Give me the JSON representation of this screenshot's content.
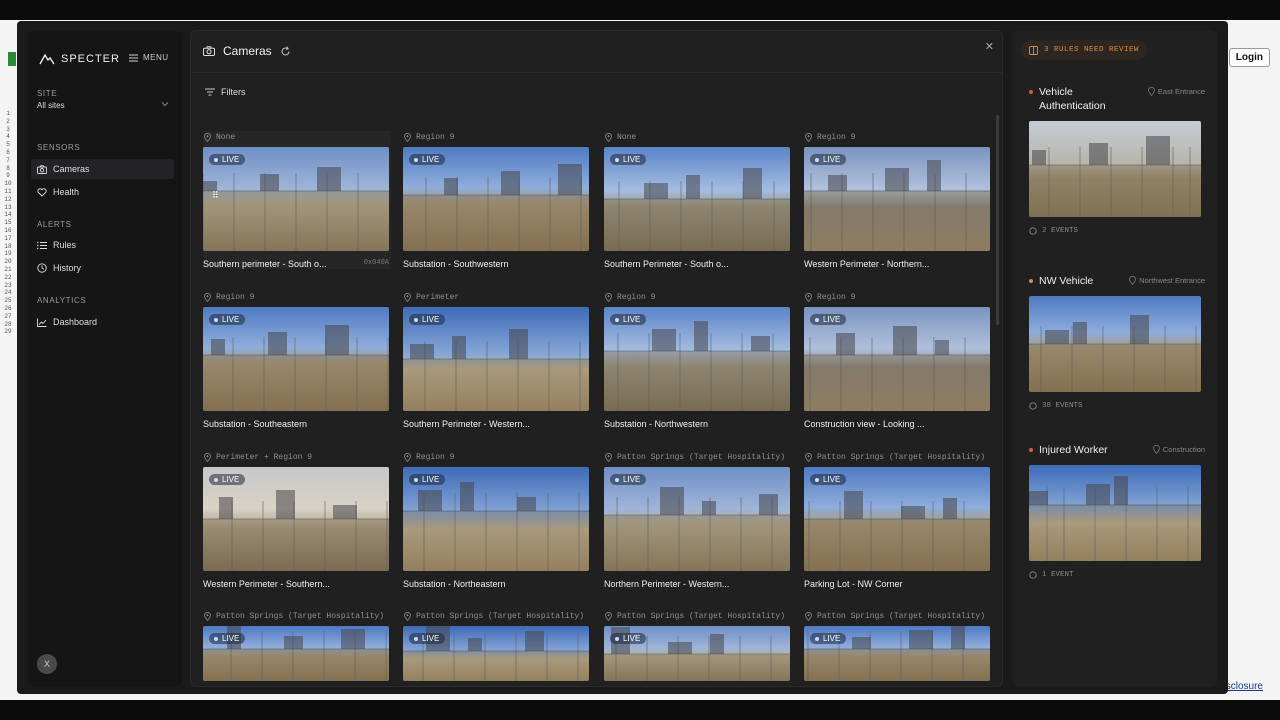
{
  "sidebar": {
    "brand": "SPECTER",
    "menu_label": "MENU",
    "site_section": "SITE",
    "site_value": "All sites",
    "sensors_section": "SENSORS",
    "sensors_items": [
      {
        "label": "Cameras"
      },
      {
        "label": "Health"
      }
    ],
    "alerts_section": "ALERTS",
    "alerts_items": [
      {
        "label": "Rules"
      },
      {
        "label": "History"
      }
    ],
    "analytics_section": "ANALYTICS",
    "analytics_items": [
      {
        "label": "Dashboard"
      }
    ],
    "user_initial": "X"
  },
  "main": {
    "title": "Cameras",
    "filters_label": "Filters",
    "live_label": "LIVE",
    "cameras": [
      {
        "region": "None",
        "title": "Southern perimeter - South o...",
        "code": "0x040A",
        "scene": "sky-a"
      },
      {
        "region": "Region 9",
        "title": "Substation - Southwestern",
        "scene": "sky-b"
      },
      {
        "region": "None",
        "title": "Southern Perimeter - South o...",
        "scene": "sky-c"
      },
      {
        "region": "Region 9",
        "title": "Western Perimeter - Northern...",
        "scene": "sky-d"
      },
      {
        "region": "Region 9",
        "title": "Substation - Southeastern",
        "scene": "sky-b"
      },
      {
        "region": "Perimeter",
        "title": "Southern Perimeter - Western...",
        "scene": "sky-e"
      },
      {
        "region": "Region 9",
        "title": "Substation - Northwestern",
        "scene": "sky-c"
      },
      {
        "region": "Region 9",
        "title": "Construction view - Looking ...",
        "scene": "sky-d"
      },
      {
        "region": "Perimeter + Region 9",
        "title": "Western Perimeter - Southern...",
        "scene": "sky-f"
      },
      {
        "region": "Region 9",
        "title": "Substation - Northeastern",
        "scene": "sky-e"
      },
      {
        "region": "Patton Springs (Target Hospitality)",
        "title": "Northern Perimeter - Western...",
        "scene": "sky-a"
      },
      {
        "region": "Patton Springs (Target Hospitality)",
        "title": "Parking Lot - NW Corner",
        "scene": "sky-b"
      },
      {
        "region": "Patton Springs (Target Hospitality)",
        "title": "",
        "scene": "sky-b"
      },
      {
        "region": "Patton Springs (Target Hospitality)",
        "title": "",
        "scene": "sky-e"
      },
      {
        "region": "Patton Springs (Target Hospitality)",
        "title": "",
        "scene": "sky-a"
      },
      {
        "region": "Patton Springs (Target Hospitality)",
        "title": "",
        "scene": "sky-b"
      }
    ]
  },
  "review": {
    "badge": "3 RULES NEED REVIEW",
    "alerts": [
      {
        "name": "Vehicle Authentication",
        "location": "East Entrance",
        "count": "2 EVENTS",
        "dot_color": "#d9534f",
        "scene": "sky-g"
      },
      {
        "name": "NW Vehicle",
        "location": "Northwest Entrance",
        "count": "38 EVENTS",
        "dot_color": "#e0823c",
        "scene": "sky-b"
      },
      {
        "name": "Injured Worker",
        "location": "Construction",
        "count": "1 EVENT",
        "dot_color": "#d9534f",
        "scene": "sky-e"
      }
    ]
  },
  "background": {
    "login_label": "Login",
    "disclosure_link": "sclosure"
  },
  "colors": {
    "accent_orange": "#e08a3c",
    "alert_red": "#d9534f",
    "panel_bg": "#202021"
  }
}
